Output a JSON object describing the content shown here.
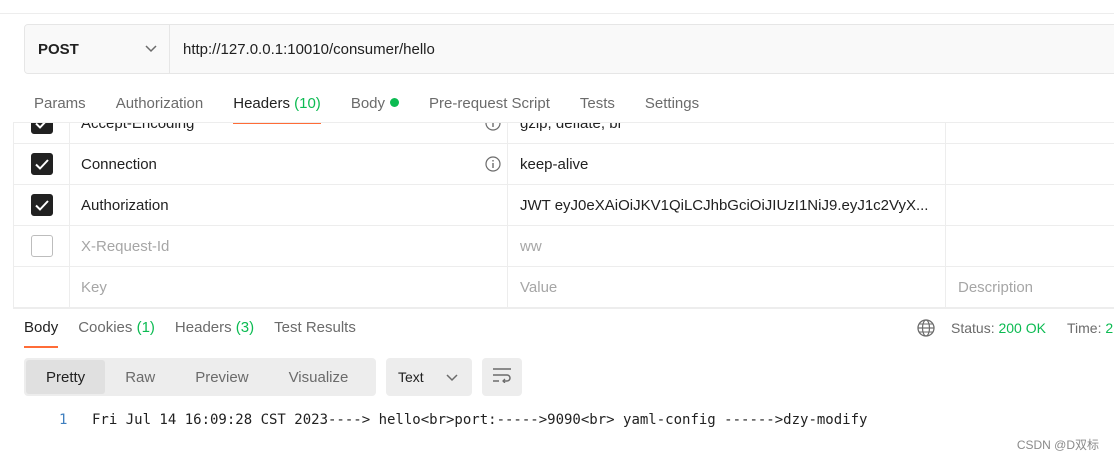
{
  "request": {
    "method": "POST",
    "url": "http://127.0.0.1:10010/consumer/hello"
  },
  "request_tabs": [
    {
      "label": "Params"
    },
    {
      "label": "Authorization"
    },
    {
      "label": "Headers",
      "count": "(10)"
    },
    {
      "label": "Body"
    },
    {
      "label": "Pre-request Script"
    },
    {
      "label": "Tests"
    },
    {
      "label": "Settings"
    }
  ],
  "headers_table": {
    "rows": [
      {
        "key": "Accept-Encoding",
        "value": "gzip, deflate, br",
        "checked": true
      },
      {
        "key": "Connection",
        "value": "keep-alive",
        "checked": true
      },
      {
        "key": "Authorization",
        "value": "JWT eyJ0eXAiOiJKV1QiLCJhbGciOiJIUzI1NiJ9.eyJ1c2VyX...",
        "checked": true
      },
      {
        "key": "X-Request-Id",
        "value": "ww",
        "checked": false
      }
    ],
    "placeholder": {
      "key": "Key",
      "value": "Value",
      "description": "Description"
    }
  },
  "response_tabs": [
    {
      "label": "Body"
    },
    {
      "label": "Cookies",
      "count": "(1)"
    },
    {
      "label": "Headers",
      "count": "(3)"
    },
    {
      "label": "Test Results"
    }
  ],
  "response_status": {
    "status_label": "Status:",
    "status_value": "200 OK",
    "time_label": "Time:",
    "time_value": "2"
  },
  "view_modes": [
    "Pretty",
    "Raw",
    "Preview",
    "Visualize"
  ],
  "format": "Text",
  "body_lines": [
    {
      "no": "1",
      "text": "Fri Jul 14 16:09:28 CST 2023----> hello<br>port:----->9090<br> yaml-config ------>dzy-modify"
    }
  ],
  "watermark": "CSDN @D双标",
  "colors": {
    "accent": "#ff6c37",
    "success": "#0cbb52",
    "line_number": "#3f7fbf"
  }
}
